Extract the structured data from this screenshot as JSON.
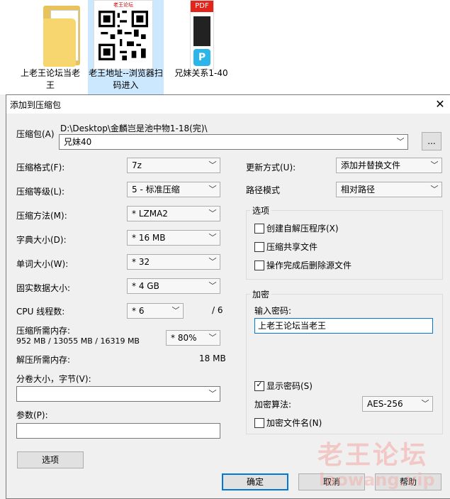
{
  "desktop": {
    "files": [
      {
        "name": "上老王论坛当老王"
      },
      {
        "name": "老王地址--浏览器扫码进入",
        "thumb_header": "老王论坛"
      },
      {
        "name": "兄妹关系1-40",
        "thumb_badge": "PDF",
        "thumb_app": "P"
      }
    ]
  },
  "dialog": {
    "title": "添加到压缩包",
    "archive": {
      "label": "压缩包(A)",
      "path": "D:\\Desktop\\金麟岂是池中物1-18(完)\\",
      "value": "兄妹40",
      "browse_label": "..."
    },
    "left": {
      "format": {
        "label": "压缩格式(F):",
        "value": "7z"
      },
      "level": {
        "label": "压缩等级(L):",
        "value": "5 - 标准压缩"
      },
      "method": {
        "label": "压缩方法(M):",
        "value": "* LZMA2"
      },
      "dict": {
        "label": "字典大小(D):",
        "value": "* 16 MB"
      },
      "word": {
        "label": "单词大小(W):",
        "value": "* 32"
      },
      "solid": {
        "label": "固实数据大小:",
        "value": "* 4 GB"
      },
      "threads": {
        "label": "CPU 线程数:",
        "value": "* 6",
        "max": "/ 6"
      },
      "mem_compress": {
        "label": "压缩所需内存:",
        "detail": "952 MB / 13055 MB / 16319 MB",
        "percent": "* 80%"
      },
      "mem_decompress": {
        "label": "解压所需内存:",
        "value": "18 MB"
      },
      "volume": {
        "label": "分卷大小，字节(V):",
        "value": ""
      },
      "params": {
        "label": "参数(P):",
        "value": ""
      },
      "options_button": "选项"
    },
    "right": {
      "update": {
        "label": "更新方式(U):",
        "value": "添加并替换文件"
      },
      "pathmode": {
        "label": "路径模式",
        "value": "相对路径"
      },
      "options_group": {
        "title": "选项",
        "sfx": "创建自解压程序(X)",
        "shared": "压缩共享文件",
        "delete": "操作完成后删除源文件"
      },
      "encrypt_group": {
        "title": "加密",
        "pwd_label": "输入密码:",
        "pwd_value": "上老王论坛当老王",
        "show_pwd": "显示密码(S)",
        "method_label": "加密算法:",
        "method_value": "AES-256",
        "encrypt_names": "加密文件名(N)"
      }
    },
    "buttons": {
      "ok": "确定",
      "cancel": "取消",
      "help": "帮助"
    },
    "watermark": {
      "text": "老王论坛",
      "url": "laowang.vip"
    }
  }
}
